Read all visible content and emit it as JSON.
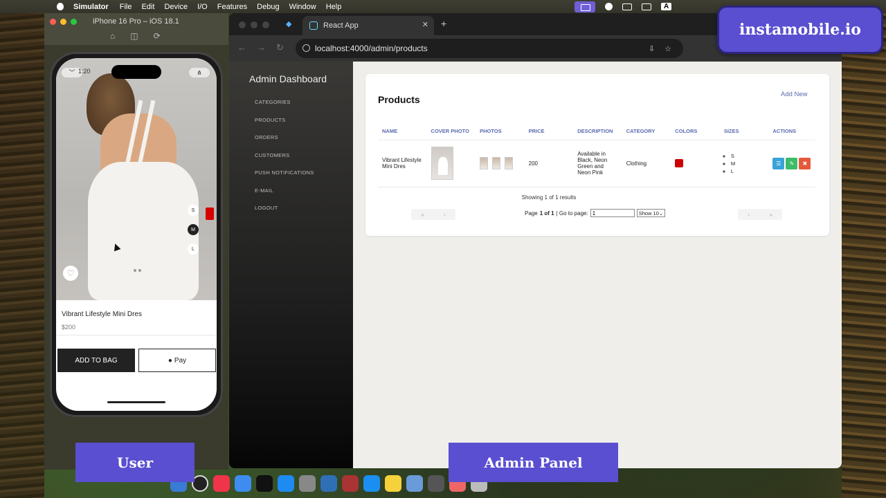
{
  "menubar": {
    "app": "Simulator",
    "items": [
      "File",
      "Edit",
      "Device",
      "I/O",
      "Features",
      "Debug",
      "Window",
      "Help"
    ]
  },
  "brand": "instamobile.io",
  "simulator": {
    "title": "iPhone 16 Pro – iOS 18.1",
    "status_time": "1:20",
    "product": {
      "name": "Vibrant Lifestyle Mini Dres",
      "price": "$200",
      "sizes": [
        "S",
        "M",
        "L"
      ],
      "selected_size": "M",
      "color": "#d60000"
    },
    "add_to_bag": "ADD TO BAG",
    "apple_pay": "Pay"
  },
  "browser": {
    "tab_title": "React App",
    "url": "localhost:4000/admin/products"
  },
  "admin": {
    "title": "Admin Dashboard",
    "nav": [
      "CATEGORIES",
      "PRODUCTS",
      "ORDERS",
      "CUSTOMERS",
      "PUSH NOTIFICATIONS",
      "E-MAIL",
      "LOGOUT"
    ],
    "page_title": "Products",
    "add_new": "Add New",
    "columns": [
      "NAME",
      "COVER PHOTO",
      "PHOTOS",
      "PRICE",
      "DESCRIPTION",
      "CATEGORY",
      "COLORS",
      "SIZES",
      "ACTIONS"
    ],
    "row": {
      "name": "Vibrant Lifestyle Mini Dres",
      "price": "200",
      "description": "Available in Black, Neon Green and Neon Pink",
      "category": "Clothing",
      "color": "#cc0000",
      "sizes": [
        "S",
        "M",
        "L"
      ]
    },
    "results": "Showing 1 of 1 results",
    "pagination": {
      "page_prefix": "Page",
      "page_value": "1 of 1",
      "goto": "| Go to page:",
      "goto_value": "1",
      "show": "Show 10"
    }
  },
  "overlays": {
    "user": "User",
    "admin": "Admin Panel"
  }
}
